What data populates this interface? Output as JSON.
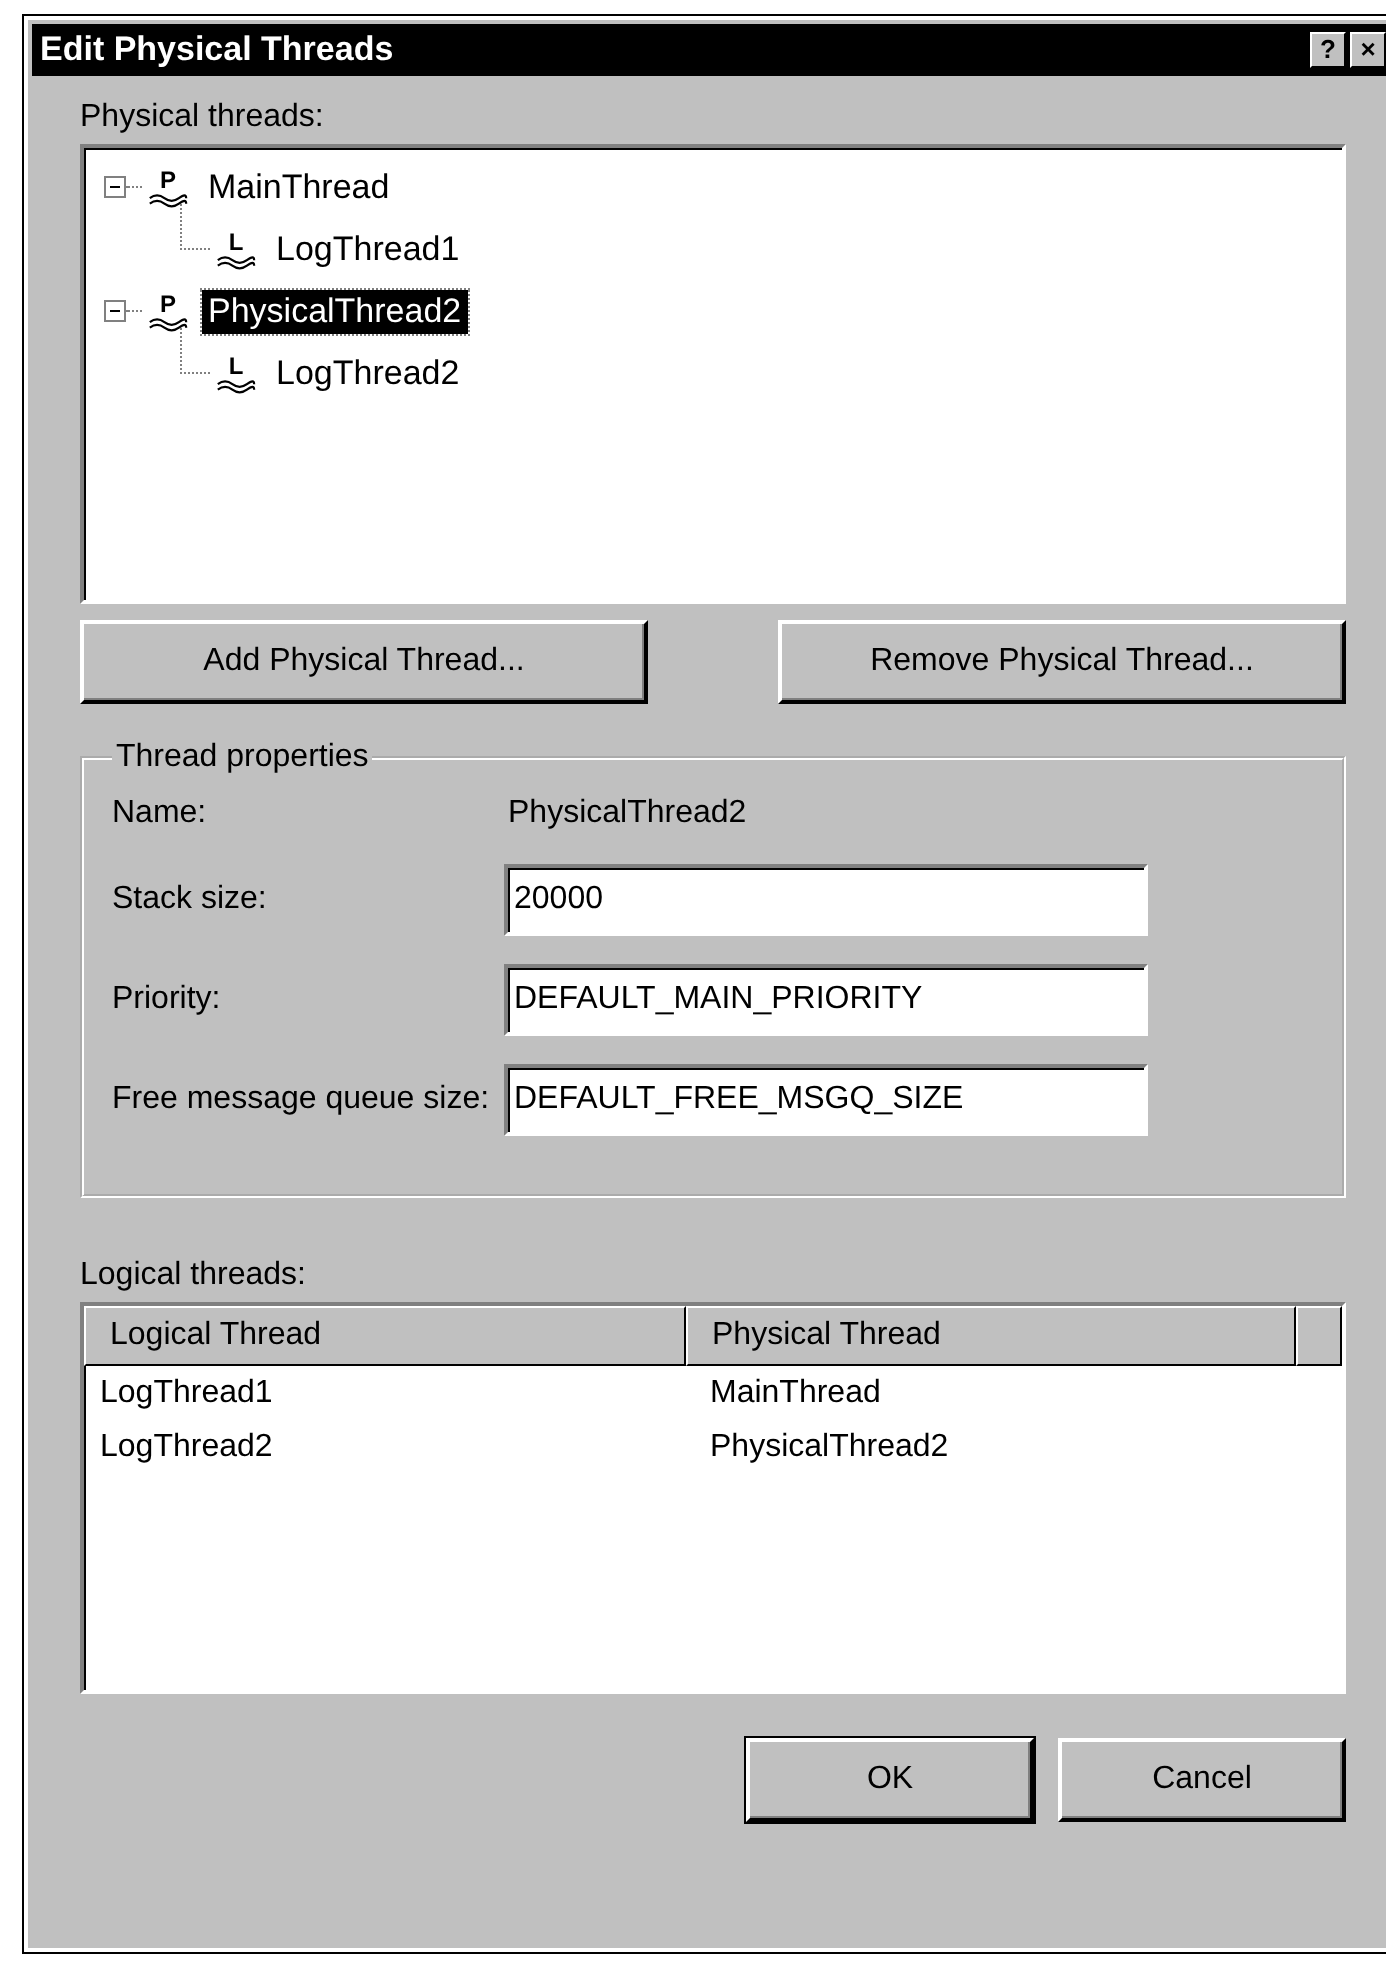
{
  "window": {
    "title": "Edit Physical Threads",
    "controls": [
      "?",
      "×"
    ]
  },
  "physical_threads": {
    "label": "Physical threads:",
    "tree": [
      {
        "icon_letter": "P",
        "label": "MainThread",
        "expanded": true,
        "selected": false,
        "children": [
          {
            "icon_letter": "L",
            "label": "LogThread1",
            "selected": false
          }
        ]
      },
      {
        "icon_letter": "P",
        "label": "PhysicalThread2",
        "expanded": true,
        "selected": true,
        "children": [
          {
            "icon_letter": "L",
            "label": "LogThread2",
            "selected": false
          }
        ]
      }
    ]
  },
  "tree_buttons": [
    {
      "label": "Add Physical Thread..."
    },
    {
      "label": "Remove Physical Thread..."
    }
  ],
  "thread_properties": {
    "title": "Thread properties",
    "fields": [
      {
        "kind": "text",
        "label": "Name:",
        "value": "PhysicalThread2"
      },
      {
        "kind": "input",
        "label": "Stack size:",
        "value": "20000"
      },
      {
        "kind": "input",
        "label": "Priority:",
        "value": "DEFAULT_MAIN_PRIORITY"
      },
      {
        "kind": "input",
        "label": "Free message queue size:",
        "value": "DEFAULT_FREE_MSGQ_SIZE"
      }
    ]
  },
  "logical_threads": {
    "label": "Logical threads:",
    "columns": [
      "Logical Thread",
      "Physical Thread"
    ],
    "rows": [
      [
        "LogThread1",
        "MainThread"
      ],
      [
        "LogThread2",
        "PhysicalThread2"
      ]
    ]
  },
  "buttons": [
    "OK",
    "Cancel"
  ]
}
